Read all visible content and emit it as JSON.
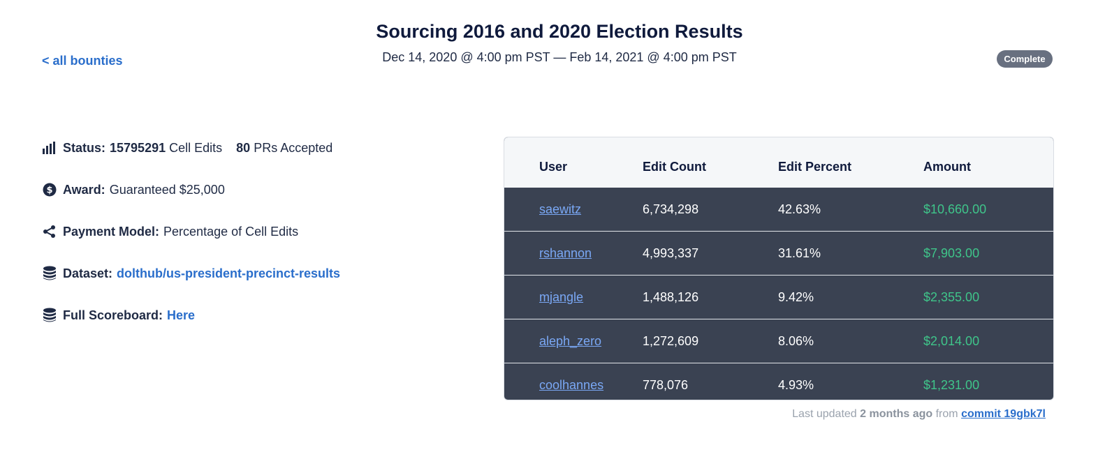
{
  "nav": {
    "back_label": "< all bounties"
  },
  "header": {
    "title": "Sourcing 2016 and 2020 Election Results",
    "dates": "Dec 14, 2020 @ 4:00 pm PST — Feb 14, 2021 @ 4:00 pm PST",
    "status_badge": "Complete"
  },
  "info": {
    "status": {
      "label": "Status:",
      "cell_edits_value": "15795291",
      "cell_edits_text": "Cell Edits",
      "prs_value": "80",
      "prs_text": "PRs Accepted"
    },
    "award": {
      "label": "Award:",
      "value": "Guaranteed $25,000"
    },
    "payment": {
      "label": "Payment Model:",
      "value": "Percentage of Cell Edits"
    },
    "dataset": {
      "label": "Dataset:",
      "value": "dolthub/us-president-precinct-results"
    },
    "scoreboard": {
      "label": "Full Scoreboard:",
      "value": "Here"
    }
  },
  "table": {
    "headers": [
      "User",
      "Edit Count",
      "Edit Percent",
      "Amount"
    ],
    "rows": [
      {
        "user": "saewitz",
        "count": "6,734,298",
        "percent": "42.63%",
        "amount": "$10,660.00"
      },
      {
        "user": "rshannon",
        "count": "4,993,337",
        "percent": "31.61%",
        "amount": "$7,903.00"
      },
      {
        "user": "mjangle",
        "count": "1,488,126",
        "percent": "9.42%",
        "amount": "$2,355.00"
      },
      {
        "user": "aleph_zero",
        "count": "1,272,609",
        "percent": "8.06%",
        "amount": "$2,014.00"
      },
      {
        "user": "coolhannes",
        "count": "778,076",
        "percent": "4.93%",
        "amount": "$1,231.00"
      }
    ]
  },
  "footer": {
    "prefix": "Last updated",
    "age": "2 months ago",
    "from": "from",
    "commit": "commit 19gbk7l"
  },
  "colors": {
    "accent": "#2a6ecb",
    "table_bg": "#3a4252",
    "amount": "#3fc58a",
    "user": "#7aa8f5",
    "badge": "#687080"
  }
}
